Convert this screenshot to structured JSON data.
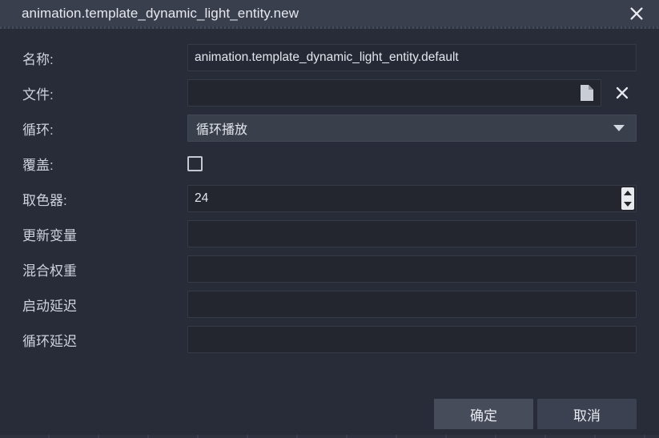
{
  "window": {
    "title": "animation.template_dynamic_light_entity.new",
    "close_icon": "close-icon",
    "accent": "#3a3f4e",
    "background": "#282c38"
  },
  "form": {
    "rows": [
      {
        "label": "名称:",
        "type": "text",
        "value": "animation.template_dynamic_light_entity.default",
        "placeholder": ""
      },
      {
        "label": "文件:",
        "type": "file",
        "value": "",
        "placeholder": "",
        "browse_icon": "document-icon",
        "clear_icon": "clear-x-icon"
      },
      {
        "label": "循环:",
        "type": "combo",
        "value": "循环播放",
        "arrow_icon": "chevron-down-icon",
        "options": [
          "循环播放"
        ]
      },
      {
        "label": "覆盖:",
        "type": "checkbox",
        "checked": false
      },
      {
        "label": "取色器:",
        "type": "spinner",
        "value": "24",
        "up_icon": "spinner-up-icon",
        "down_icon": "spinner-down-icon"
      },
      {
        "label": "更新变量",
        "type": "text",
        "value": "",
        "placeholder": ""
      },
      {
        "label": "混合权重",
        "type": "text",
        "value": "",
        "placeholder": ""
      },
      {
        "label": "启动延迟",
        "type": "text",
        "value": "",
        "placeholder": ""
      },
      {
        "label": "循环延迟",
        "type": "text",
        "value": "",
        "placeholder": ""
      }
    ]
  },
  "footer": {
    "ok_label": "确定",
    "cancel_label": "取消"
  }
}
